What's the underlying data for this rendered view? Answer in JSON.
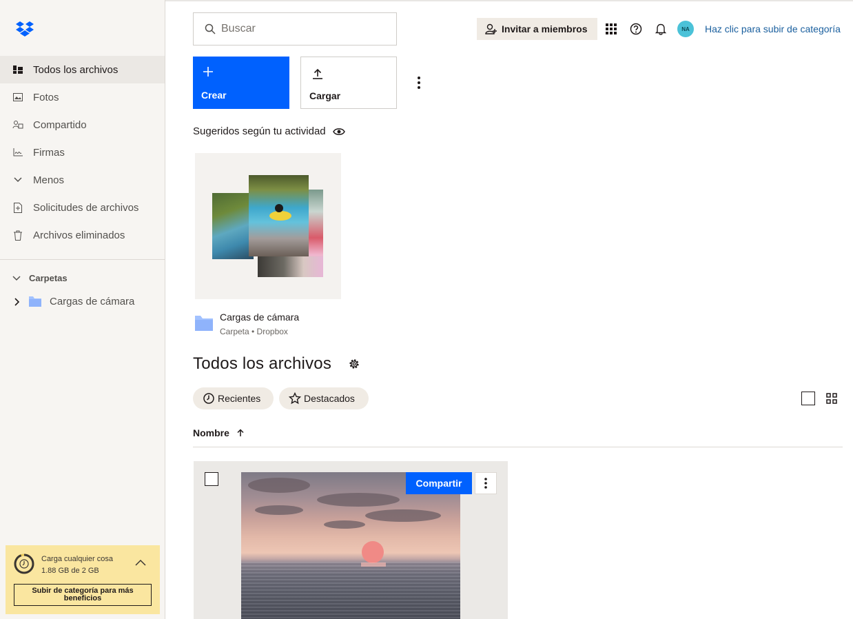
{
  "sidebar": {
    "items": [
      {
        "label": "Todos los archivos",
        "icon": "all-files-icon",
        "active": true
      },
      {
        "label": "Fotos",
        "icon": "photos-icon"
      },
      {
        "label": "Compartido",
        "icon": "shared-icon"
      },
      {
        "label": "Firmas",
        "icon": "signatures-icon"
      },
      {
        "label": "Menos",
        "icon": "chevron-down-icon"
      },
      {
        "label": "Solicitudes de archivos",
        "icon": "file-requests-icon"
      },
      {
        "label": "Archivos eliminados",
        "icon": "trash-icon"
      }
    ],
    "folders_heading": "Carpetas",
    "folder_item": "Cargas de cámara",
    "upgrade": {
      "title": "Carga cualquier cosa",
      "usage": "1.88 GB de 2 GB",
      "usage_fraction": 0.94,
      "button": "Subir de categoría para más beneficios"
    }
  },
  "topbar": {
    "search_placeholder": "Buscar",
    "invite_label": "Invitar a miembros",
    "avatar_initials": "NA",
    "upsell_link": "Haz clic para subir de categoría"
  },
  "actions": {
    "create_label": "Crear",
    "upload_label": "Cargar"
  },
  "suggested": {
    "heading": "Sugeridos según tu actividad",
    "card": {
      "name": "Cargas de cámara",
      "meta": "Carpeta • Dropbox"
    }
  },
  "files": {
    "title": "Todos los archivos",
    "filters": [
      "Recientes",
      "Destacados"
    ],
    "sort_column": "Nombre",
    "tile": {
      "share_label": "Compartir"
    }
  },
  "colors": {
    "accent": "#0061fe",
    "sidebar_bg": "#f7f5f2",
    "upgrade_bg": "#fae6a0",
    "link": "#1a5f9e"
  }
}
